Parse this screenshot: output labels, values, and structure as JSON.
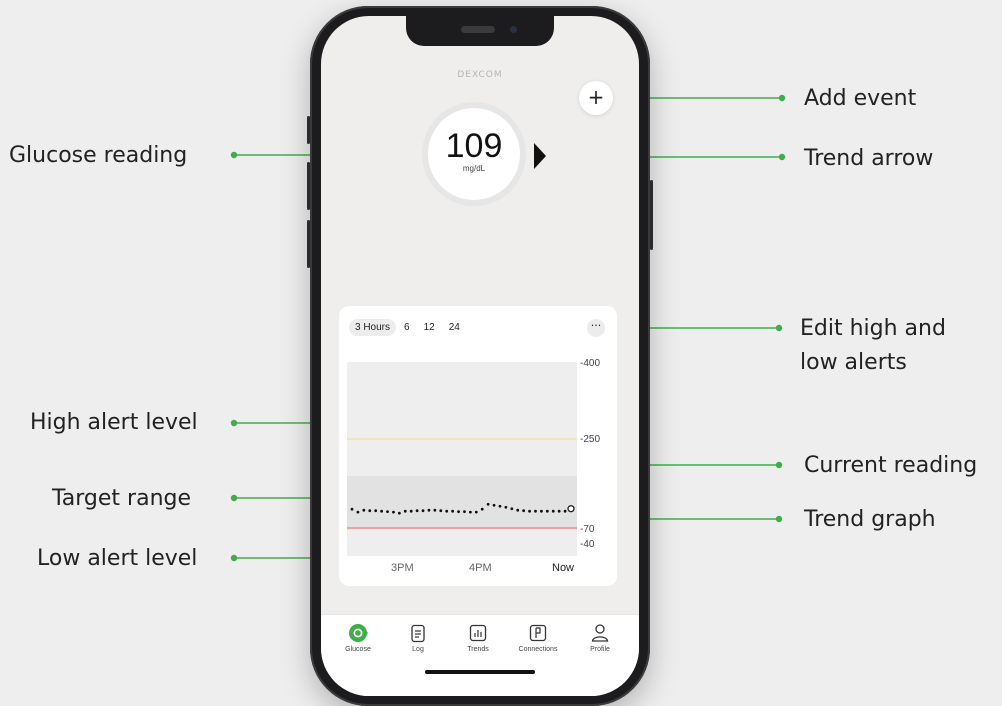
{
  "annotations": {
    "add_event": "Add event",
    "glucose_reading": "Glucose reading",
    "trend_arrow": "Trend arrow",
    "edit_alerts_line1": "Edit high and",
    "edit_alerts_line2": "low alerts",
    "high_alert_level": "High alert level",
    "current_reading": "Current reading",
    "target_range": "Target range",
    "trend_graph": "Trend graph",
    "low_alert_level": "Low alert level"
  },
  "app": {
    "brand": "DEXCOM",
    "add_button": "+",
    "glucose_value": "109",
    "glucose_unit": "mg/dL",
    "trend_direction": "steady"
  },
  "graph": {
    "tabs": [
      "3 Hours",
      "6",
      "12",
      "24"
    ],
    "active_tab": "3 Hours",
    "more_button": "···",
    "y_ticks": [
      "400",
      "250",
      "70",
      "40"
    ],
    "x_ticks": [
      "3PM",
      "4PM",
      "Now"
    ]
  },
  "chart_data": {
    "type": "scatter",
    "x_ticks": [
      "3PM",
      "4PM",
      "Now"
    ],
    "y_ticks": [
      400,
      250,
      70,
      40
    ],
    "high_alert": 250,
    "low_alert": 70,
    "series": [
      {
        "values": [
          108,
          102,
          106,
          105,
          105,
          104,
          103,
          102,
          100,
          104,
          104,
          105,
          105,
          106,
          106,
          105,
          104,
          104,
          103,
          103,
          102,
          102,
          108,
          118,
          116,
          114,
          112,
          109,
          106,
          105,
          104,
          104,
          104,
          104,
          104,
          104,
          104,
          109
        ]
      }
    ]
  },
  "nav": [
    {
      "label": "Glucose",
      "icon": "glucose-icon",
      "active": true
    },
    {
      "label": "Log",
      "icon": "clipboard-icon",
      "active": false
    },
    {
      "label": "Trends",
      "icon": "bar-chart-icon",
      "active": false
    },
    {
      "label": "Connections",
      "icon": "connections-icon",
      "active": false
    },
    {
      "label": "Profile",
      "icon": "person-icon",
      "active": false
    }
  ],
  "colors": {
    "accent_green": "#3fae49",
    "high_line": "#f1d98a",
    "low_line": "#e06a6a"
  }
}
